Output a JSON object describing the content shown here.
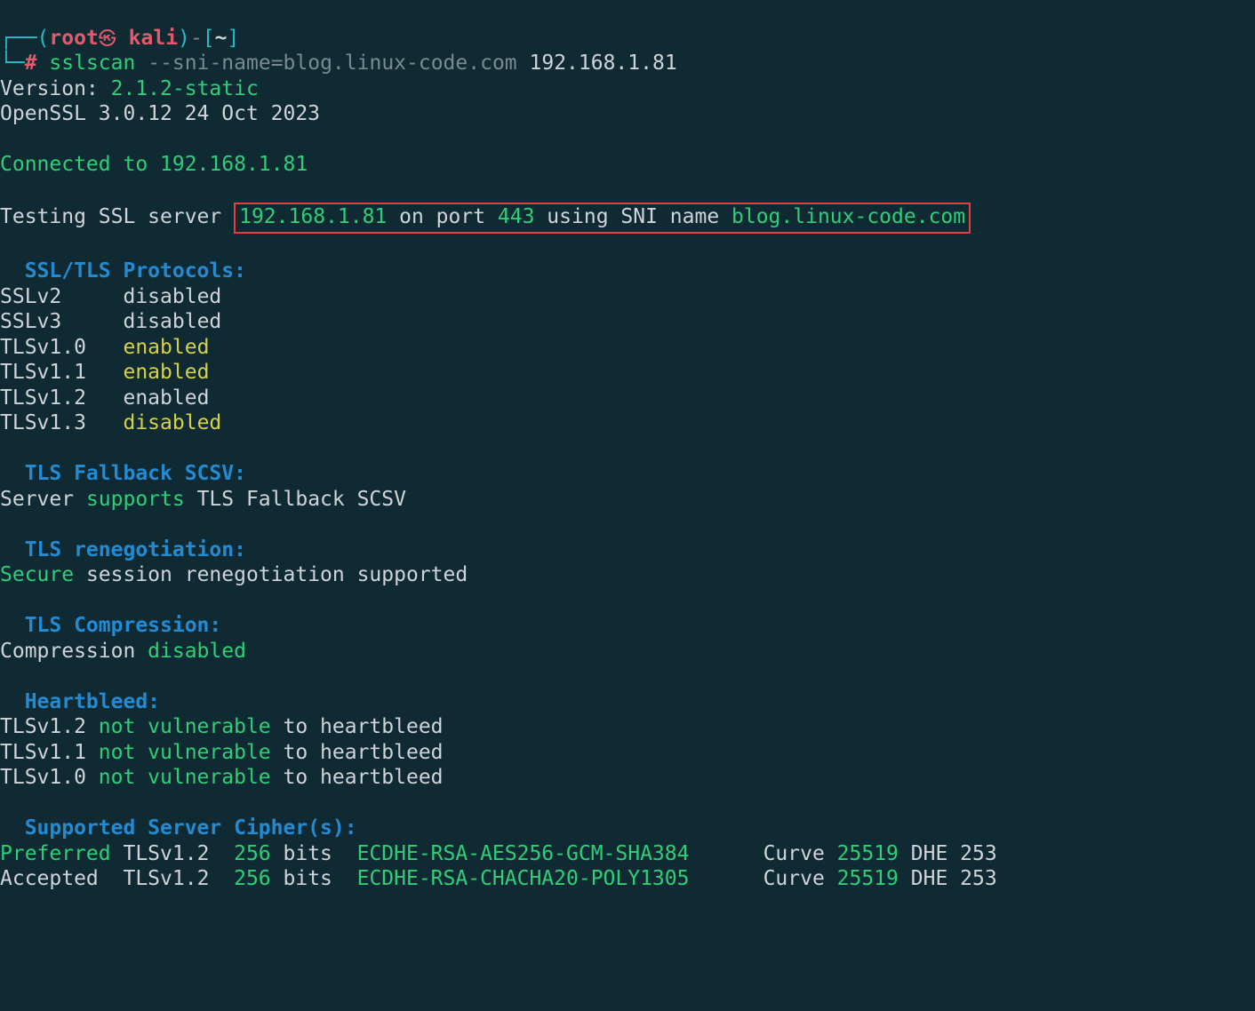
{
  "prompt": {
    "corner_top": "┌──",
    "corner_bot": "└─",
    "paren_open": "(",
    "user": "root",
    "skull": "㉿",
    "host": "kali",
    "paren_close": ")",
    "dash": "-",
    "bracket_open": "[",
    "cwd": "~",
    "bracket_close": "]",
    "hash": "#",
    "cmd": "sslscan",
    "arg1": "--sni-name=blog.linux-code.com",
    "arg2": "192.168.1.81"
  },
  "version": {
    "label": "Version:",
    "value": "2.1.2-static",
    "openssl": "OpenSSL 3.0.12 24 Oct 2023"
  },
  "connected": {
    "label": "Connected to ",
    "ip": "192.168.1.81"
  },
  "testing": {
    "pre": "Testing SSL server ",
    "ip": "192.168.1.81",
    "mid1": " on port ",
    "port": "443",
    "mid2": " using SNI name ",
    "sni": "blog.linux-code.com"
  },
  "protocols": {
    "header": "  SSL/TLS Protocols:",
    "rows": {
      "p0": {
        "name": "SSLv2     ",
        "state": "disabled"
      },
      "p1": {
        "name": "SSLv3     ",
        "state": "disabled"
      },
      "p2": {
        "name": "TLSv1.0   ",
        "state": "enabled"
      },
      "p3": {
        "name": "TLSv1.1   ",
        "state": "enabled"
      },
      "p4": {
        "name": "TLSv1.2   ",
        "state": "enabled"
      },
      "p5": {
        "name": "TLSv1.3   ",
        "state": "disabled"
      }
    }
  },
  "fallback": {
    "header": "  TLS Fallback SCSV:",
    "pre": "Server ",
    "supports": "supports",
    "post": " TLS Fallback SCSV"
  },
  "reneg": {
    "header": "  TLS renegotiation:",
    "secure": "Secure",
    "post": " session renegotiation supported"
  },
  "compression": {
    "header": "  TLS Compression:",
    "pre": "Compression ",
    "state": "disabled"
  },
  "heartbleed": {
    "header": "  Heartbleed:",
    "rows": {
      "h0": {
        "ver": "TLSv1.2 ",
        "nv": "not vulnerable",
        "post": " to heartbleed"
      },
      "h1": {
        "ver": "TLSv1.1 ",
        "nv": "not vulnerable",
        "post": " to heartbleed"
      },
      "h2": {
        "ver": "TLSv1.0 ",
        "nv": "not vulnerable",
        "post": " to heartbleed"
      }
    }
  },
  "ciphers": {
    "header": "  Supported Server Cipher(s):",
    "rows": {
      "c0": {
        "pref": "Preferred ",
        "ver": "TLSv1.2  ",
        "bits": "256",
        "bitslabel": " bits  ",
        "cipher": "ECDHE-RSA-AES256-GCM-SHA384      ",
        "curvelabel": "Curve ",
        "curve": "25519",
        "dhe": " DHE 253"
      },
      "c1": {
        "pref": "Accepted  ",
        "ver": "TLSv1.2  ",
        "bits": "256",
        "bitslabel": " bits  ",
        "cipher": "ECDHE-RSA-CHACHA20-POLY1305      ",
        "curvelabel": "Curve ",
        "curve": "25519",
        "dhe": " DHE 253"
      }
    }
  }
}
